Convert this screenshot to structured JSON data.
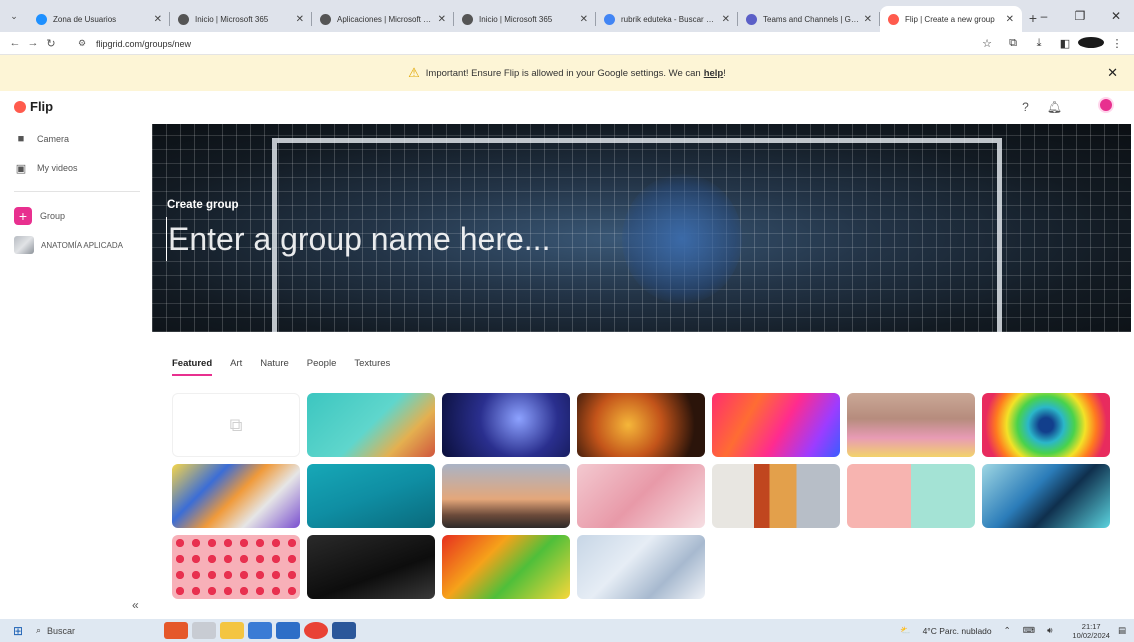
{
  "browser": {
    "tabs": [
      {
        "title": "Zona de Usuarios",
        "color": "#1e90ff"
      },
      {
        "title": "Inicio | Microsoft 365",
        "color": "#555555"
      },
      {
        "title": "Aplicaciones | Microsoft 365",
        "color": "#555555"
      },
      {
        "title": "Inicio | Microsoft 365",
        "color": "#555555"
      },
      {
        "title": "rubrik eduteka - Buscar con Go",
        "color": "#4285f4"
      },
      {
        "title": "Teams and Channels | General |",
        "color": "#5b5fc7"
      },
      {
        "title": "Flip | Create a new group",
        "color": "#ff5b4d"
      }
    ],
    "url": "flipgrid.com/groups/new"
  },
  "banner": {
    "text": "Important! Ensure Flip is allowed in your Google settings. We can",
    "link": "help",
    "suffix": "!"
  },
  "app": {
    "name": "Flip"
  },
  "sidebar": {
    "items": [
      {
        "label": "Camera",
        "icon": "camera-icon"
      },
      {
        "label": "My videos",
        "icon": "video-icon"
      }
    ],
    "group_button": "Group",
    "groups": [
      {
        "label": "ANATOMÍA APLICADA"
      }
    ]
  },
  "hero": {
    "label": "Create group",
    "placeholder": "Enter a group name here..."
  },
  "categories": [
    "Featured",
    "Art",
    "Nature",
    "People",
    "Textures"
  ],
  "selected_category": "Featured",
  "thumbnails": [
    {
      "name": "empty",
      "bg": "#ffffff"
    },
    {
      "name": "books",
      "bg": "linear-gradient(135deg,#3cc6c0,#5fd6cc 50%,#e4b050 75%,#d0553d)"
    },
    {
      "name": "galaxy",
      "bg": "radial-gradient(circle at 60% 40%,#8da2ff,#2a2f8e 45%,#0a0f3a)"
    },
    {
      "name": "bubbles",
      "bg": "radial-gradient(circle at 40% 50%,#f5b73a,#c3541a 40%,#2b140a 80%)"
    },
    {
      "name": "rainbow-lines",
      "bg": "linear-gradient(120deg,#ff2d6f,#ff6c33 30%,#ff2b8f 55%,#9d3cff 80%,#3a5dff)"
    },
    {
      "name": "balloons",
      "bg": "linear-gradient(180deg,#caa896,#b68c7d 40%,#e89bb5 70%,#f2d36a)"
    },
    {
      "name": "spiral",
      "bg": "radial-gradient(circle,#123f8c 10%,#2bb7c9 25%,#49d24c 40%,#f3e227 55%,#ff7a1f 70%,#e82b5e 85%)"
    },
    {
      "name": "marble",
      "bg": "linear-gradient(135deg,#f6d64a,#3b6dd6 30%,#f09a3a 50%,#e6e6e6 70%,#7a4fd0)"
    },
    {
      "name": "underwater",
      "bg": "linear-gradient(160deg,#17a8b7,#0f8ea3 50%,#0a6a7c)"
    },
    {
      "name": "hot-air-balloons",
      "bg": "linear-gradient(180deg,#a9b3c5,#e4a77a 55%,#6b4a3a 80%,#2e2a2a)"
    },
    {
      "name": "sprinkles",
      "bg": "linear-gradient(135deg,#f3c9d0,#e899a8 50%,#f6dfe3)"
    },
    {
      "name": "lockers",
      "bg": "linear-gradient(90deg,#e8e6e1 0 33%,#c0461f 33% 45%,#e3a04b 45% 66%,#b7bec7 66%)"
    },
    {
      "name": "headphones",
      "bg": "linear-gradient(90deg,#f7b4b0 0 50%,#a4e3d5 50%)"
    },
    {
      "name": "ink",
      "bg": "linear-gradient(135deg,#9fd7e3,#2b7cb9 40%,#0f2f4d 60%,#5bd3de)"
    },
    {
      "name": "red-dots",
      "bg": "radial-gradient(circle,#e8304f 35%,#f7b0b8 37%)"
    },
    {
      "name": "guitar",
      "bg": "linear-gradient(160deg,#2a2a2a,#0d0d0d 60%,#3a3a3a)"
    },
    {
      "name": "gummy-bears",
      "bg": "linear-gradient(135deg,#e62f1f,#f6a21a 35%,#4fbf3a 60%,#f7d73a)"
    },
    {
      "name": "tinsel",
      "bg": "linear-gradient(135deg,#c7d6e6,#e6edf5 40%,#a7b9cf 70%,#f0f3f8)"
    }
  ],
  "taskbar": {
    "search": "Buscar",
    "weather": "4°C  Parc. nublado",
    "time": "21:17",
    "date": "10/02/2024"
  }
}
